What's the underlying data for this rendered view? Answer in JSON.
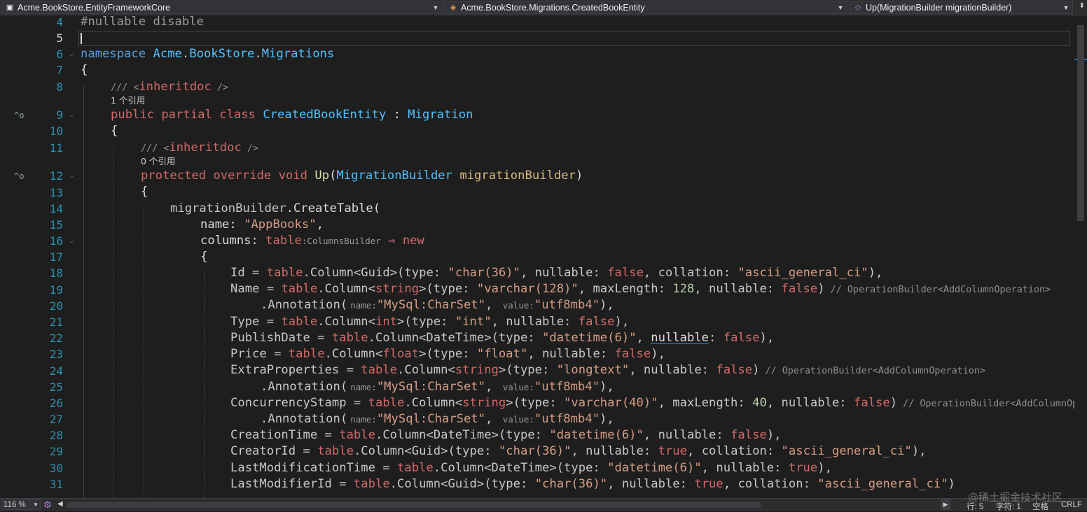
{
  "navbar": {
    "project": "Acme.BookStore.EntityFrameworkCore",
    "type": "Acme.BookStore.Migrations.CreatedBookEntity",
    "member": "Up(MigrationBuilder migrationBuilder)",
    "icons": [
      "csharp-project-icon",
      "class-icon",
      "method-icon"
    ]
  },
  "editor": {
    "current_line": "5",
    "line_numbers": [
      "4",
      "5",
      "6",
      "7",
      "8",
      "9",
      "10",
      "11",
      "12",
      "13",
      "14",
      "15",
      "16",
      "17",
      "18",
      "19",
      "20",
      "21",
      "22",
      "23",
      "24",
      "25",
      "26",
      "27",
      "28",
      "29",
      "30",
      "31"
    ],
    "codelens": [
      "1 个引用",
      "0 个引用"
    ],
    "code": {
      "l4": "#nullable disable",
      "l6_kw": "namespace",
      "l6_ns1": "Acme",
      "l6_ns2": "BookStore",
      "l6_ns3": "Migrations",
      "l7": "{",
      "l8_a": "/// <",
      "l8_b": "inheritdoc",
      "l8_c": " />",
      "l9_kw": "public partial class",
      "l9_cls": "CreatedBookEntity",
      "l9_sep": " : ",
      "l9_base": "Migration",
      "l10": "{",
      "l11_a": "/// <",
      "l11_b": "inheritdoc",
      "l11_c": " />",
      "l12_kw": "protected override void",
      "l12_m": "Up",
      "l12_p1": "(",
      "l12_t": "MigrationBuilder",
      "l12_v": "migrationBuilder",
      "l12_p2": ")",
      "l13": "{",
      "l14_a": "migrationBuilder",
      "l14_b": ".CreateTable(",
      "l15_a": "name: ",
      "l15_s": "\"AppBooks\"",
      "l15_c": ",",
      "l16_a": "columns: ",
      "l16_b": "table",
      "l16_hint": ":ColumnsBuilder",
      "l16_arrow": " ⇒ ",
      "l16_new": "new",
      "l17": "{",
      "l18": [
        "Id = ",
        "table",
        ".Column<",
        "Guid",
        ">(type: ",
        "\"char(36)\"",
        ", nullable: ",
        "false",
        ", collation: ",
        "\"ascii_general_ci\"",
        "),"
      ],
      "l19": [
        "Name = ",
        "table",
        ".Column<",
        "string",
        ">(type: ",
        "\"varchar(128)\"",
        ", maxLength: ",
        "128",
        ", nullable: ",
        "false",
        ")",
        "// OperationBuilder<AddColumnOperation>"
      ],
      "l20": [
        ".Annotation(",
        "name:",
        "\"MySql:CharSet\"",
        ", ",
        "value:",
        "\"utf8mb4\"",
        "),"
      ],
      "l21": [
        "Type = ",
        "table",
        ".Column<",
        "int",
        ">(type: ",
        "\"int\"",
        ", nullable: ",
        "false",
        "),"
      ],
      "l22": [
        "PublishDate = ",
        "table",
        ".Column<",
        "DateTime",
        ">(type: ",
        "\"datetime(6)\"",
        ", ",
        "nullable",
        ": ",
        "false",
        "),"
      ],
      "l23": [
        "Price = ",
        "table",
        ".Column<",
        "float",
        ">(type: ",
        "\"float\"",
        ", nullable: ",
        "false",
        "),"
      ],
      "l24": [
        "ExtraProperties = ",
        "table",
        ".Column<",
        "string",
        ">(type: ",
        "\"longtext\"",
        ", nullable: ",
        "false",
        ")",
        "// OperationBuilder<AddColumnOperation>"
      ],
      "l25": [
        ".Annotation(",
        "name:",
        "\"MySql:CharSet\"",
        ", ",
        "value:",
        "\"utf8mb4\"",
        "),"
      ],
      "l26": [
        "ConcurrencyStamp = ",
        "table",
        ".Column<",
        "string",
        ">(type: ",
        "\"varchar(40)\"",
        ", maxLength: ",
        "40",
        ", nullable: ",
        "false",
        ")",
        "// OperationBuilder<AddColumnOperation>"
      ],
      "l27": [
        ".Annotation(",
        "name:",
        "\"MySql:CharSet\"",
        ", ",
        "value:",
        "\"utf8mb4\"",
        "),"
      ],
      "l28": [
        "CreationTime = ",
        "table",
        ".Column<",
        "DateTime",
        ">(type: ",
        "\"datetime(6)\"",
        ", nullable: ",
        "false",
        "),"
      ],
      "l29": [
        "CreatorId = ",
        "table",
        ".Column<",
        "Guid",
        ">(type: ",
        "\"char(36)\"",
        ", nullable: ",
        "true",
        ", collation: ",
        "\"ascii_general_ci\"",
        "),"
      ],
      "l30": [
        "LastModificationTime = ",
        "table",
        ".Column<",
        "DateTime",
        ">(type: ",
        "\"datetime(6)\"",
        ", nullable: ",
        "true",
        "),"
      ],
      "l31": [
        "LastModifierId = ",
        "table",
        ".Column<",
        "Guid",
        ">(type: ",
        "\"char(36)\"",
        ", nullable: ",
        "true",
        ", collation: ",
        "\"ascii_general_ci\"",
        ")"
      ]
    }
  },
  "bottombar": {
    "zoom": "116 %",
    "line": "行: 5",
    "char": "字符: 1",
    "spaces": "空格",
    "eol": "CRLF"
  },
  "watermark": "@稀土掘金技术社区",
  "colors": {
    "background": "#1e1e1e",
    "keyword": "#569cd6",
    "control_keyword": "#d16969",
    "type": "#4ec9b0",
    "string": "#d69d85",
    "number": "#b5cea8",
    "line_number": "#2b91af"
  }
}
